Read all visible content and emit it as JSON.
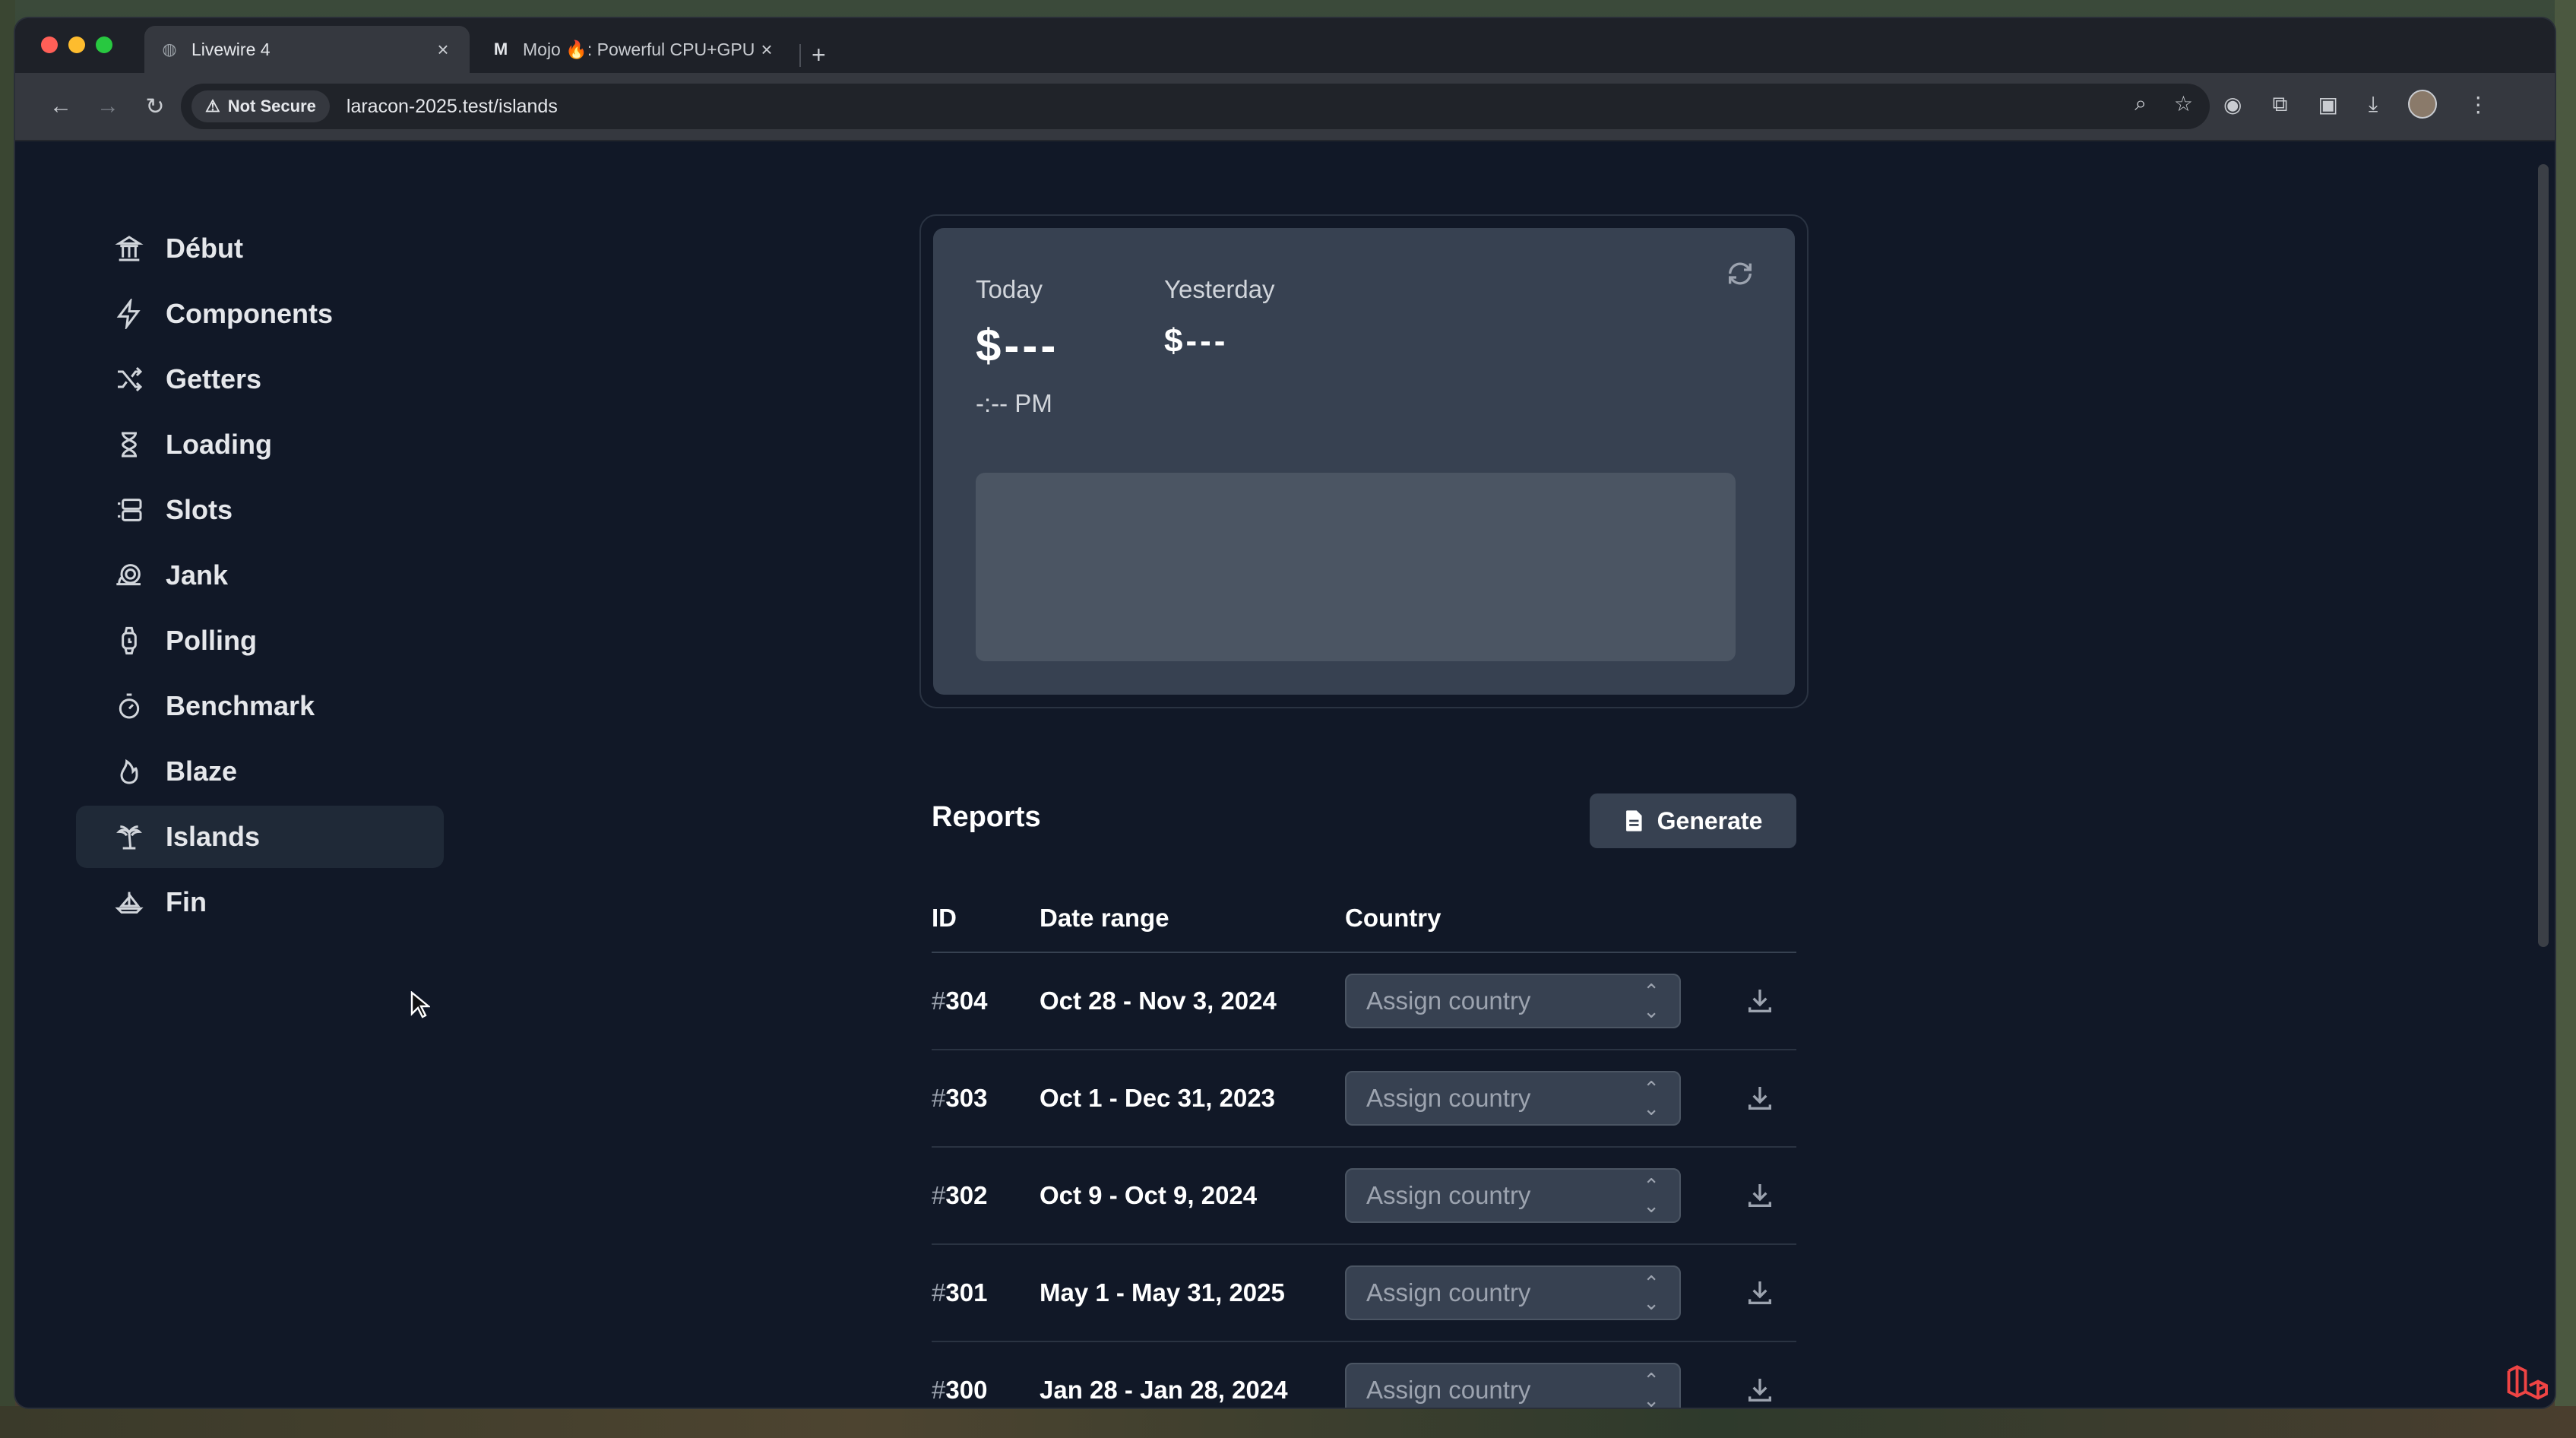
{
  "browser": {
    "tabs": [
      {
        "title": "Livewire 4",
        "active": true
      },
      {
        "title": "Mojo 🔥: Powerful CPU+GPU",
        "active": false
      }
    ],
    "security_label": "Not Secure",
    "url": "laracon-2025.test/islands"
  },
  "sidebar": {
    "items": [
      {
        "label": "Début",
        "icon": "building-columns-icon"
      },
      {
        "label": "Components",
        "icon": "bolt-icon"
      },
      {
        "label": "Getters",
        "icon": "shuffle-icon"
      },
      {
        "label": "Loading",
        "icon": "hourglass-icon"
      },
      {
        "label": "Slots",
        "icon": "slots-icon"
      },
      {
        "label": "Jank",
        "icon": "snail-icon"
      },
      {
        "label": "Polling",
        "icon": "watch-icon"
      },
      {
        "label": "Benchmark",
        "icon": "timer-icon"
      },
      {
        "label": "Blaze",
        "icon": "flame-icon"
      },
      {
        "label": "Islands",
        "icon": "palm-tree-icon",
        "active": true
      },
      {
        "label": "Fin",
        "icon": "sailboat-icon"
      }
    ]
  },
  "stats": {
    "today_label": "Today",
    "today_value": "$---",
    "time": "-:-- PM",
    "yesterday_label": "Yesterday",
    "yesterday_value": "$---"
  },
  "reports": {
    "title": "Reports",
    "generate_label": "Generate",
    "columns": [
      "ID",
      "Date range",
      "Country"
    ],
    "select_placeholder": "Assign country",
    "rows": [
      {
        "id": "304",
        "range": "Oct 28 - Nov 3, 2024"
      },
      {
        "id": "303",
        "range": "Oct 1 - Dec 31, 2023"
      },
      {
        "id": "302",
        "range": "Oct 9 - Oct 9, 2024"
      },
      {
        "id": "301",
        "range": "May 1 - May 31, 2025"
      },
      {
        "id": "300",
        "range": "Jan 28 - Jan 28, 2024"
      }
    ]
  }
}
